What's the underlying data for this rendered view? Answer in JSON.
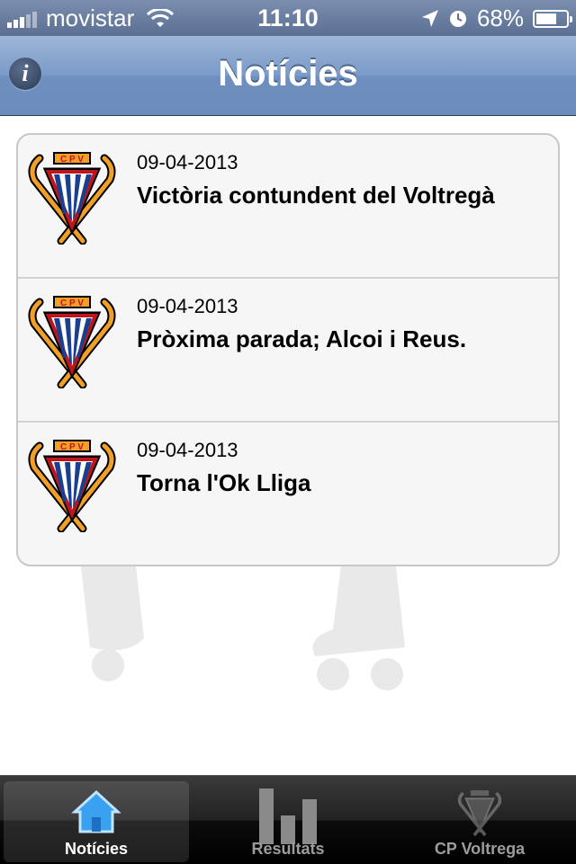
{
  "status_bar": {
    "carrier": "movistar",
    "time": "11:10",
    "battery_percent": "68%",
    "battery_level": 0.68
  },
  "nav": {
    "title": "Notícies",
    "info_icon": "info-icon"
  },
  "news": [
    {
      "date": "09-04-2013",
      "title": "Victòria contundent del Voltregà"
    },
    {
      "date": "09-04-2013",
      "title": "Pròxima parada; Alcoi i Reus."
    },
    {
      "date": "09-04-2013",
      "title": "Torna l'Ok Lliga"
    }
  ],
  "tabs": [
    {
      "label": "Notícies",
      "icon": "home-icon",
      "selected": true
    },
    {
      "label": "Resultats",
      "icon": "bar-chart-icon",
      "selected": false
    },
    {
      "label": "CP Voltrega",
      "icon": "club-crest-icon",
      "selected": false
    }
  ],
  "colors": {
    "navbar": "#7a9ac8",
    "crest_blue": "#1b3f8f",
    "crest_red": "#c0141b",
    "crest_orange": "#f0a028"
  }
}
